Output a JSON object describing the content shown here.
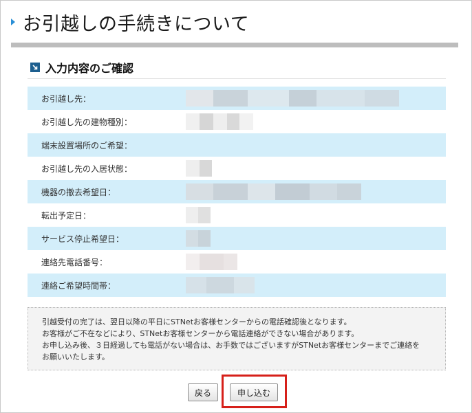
{
  "page": {
    "title": "お引越しの手続きについて"
  },
  "section": {
    "title": "入力内容のご確認",
    "icon": "arrow-box-icon"
  },
  "form_rows": [
    {
      "label": "お引越し先："
    },
    {
      "label": "お引越し先の建物種別："
    },
    {
      "label": "端末設置場所のご希望："
    },
    {
      "label": "お引越し先の入居状態："
    },
    {
      "label": "機器の撤去希望日："
    },
    {
      "label": "転出予定日："
    },
    {
      "label": "サービス停止希望日："
    },
    {
      "label": "連絡先電話番号："
    },
    {
      "label": "連絡ご希望時間帯："
    }
  ],
  "notice": {
    "lines": [
      "引越受付の完了は、翌日以降の平日にSTNetお客様センターからの電話確認後となります。",
      "お客様がご不在などにより、STNetお客様センターから電話連絡ができない場合があります。",
      "お申し込み後、３日経過しても電話がない場合は、お手数ではございますがSTNetお客様センターまでご連絡を",
      "お願いいたします。"
    ]
  },
  "buttons": {
    "back_label": "戻る",
    "apply_label": "申し込む"
  },
  "colors": {
    "row_highlight": "#d3eefa",
    "accent_blue": "#1d5f8f",
    "highlight_box": "#d6201a"
  }
}
